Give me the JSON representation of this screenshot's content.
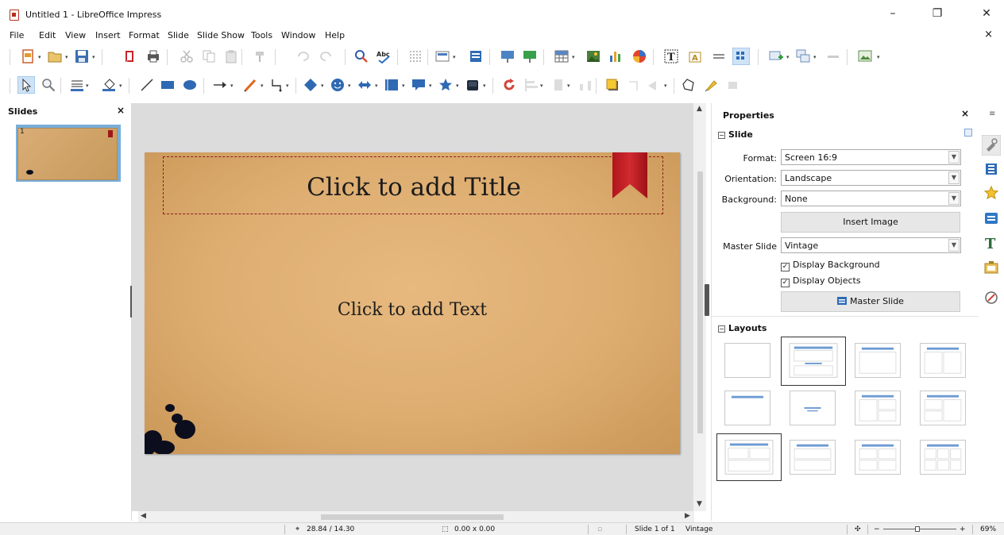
{
  "window": {
    "title": "Untitled 1 - LibreOffice Impress",
    "minimize_glyph": "–",
    "restore_glyph": "❐",
    "close_glyph": "✕"
  },
  "menu": {
    "items": [
      "File",
      "Edit",
      "View",
      "Insert",
      "Format",
      "Slide",
      "Slide Show",
      "Tools",
      "Window",
      "Help"
    ],
    "close_glyph": "×"
  },
  "slides_pane": {
    "title": "Slides",
    "close_glyph": "×",
    "thumbnails": [
      {
        "number": "1"
      }
    ]
  },
  "slide": {
    "title_placeholder": "Click to add Title",
    "body_placeholder": "Click to add Text"
  },
  "properties": {
    "title": "Properties",
    "close_glyph": "×",
    "slide_section": "Slide",
    "format_label": "Format:",
    "format_value": "Screen 16:9",
    "orientation_label": "Orientation:",
    "orientation_value": "Landscape",
    "background_label": "Background:",
    "background_value": "None",
    "insert_image_label": "Insert Image",
    "master_slide_label": "Master Slide",
    "master_slide_value": "Vintage",
    "display_background_label": "Display Background",
    "display_objects_label": "Display Objects",
    "master_slide_button": "Master Slide",
    "layouts_section": "Layouts",
    "collapse_glyph": "−"
  },
  "status": {
    "position": "28.84 / 14.30",
    "size": "0.00 x 0.00",
    "slide": "Slide 1 of 1",
    "master": "Vintage",
    "zoom": "69%"
  },
  "colors": {
    "accent": "#c0282e",
    "slide_bg": "#ddad70",
    "selection": "#79aed8"
  }
}
